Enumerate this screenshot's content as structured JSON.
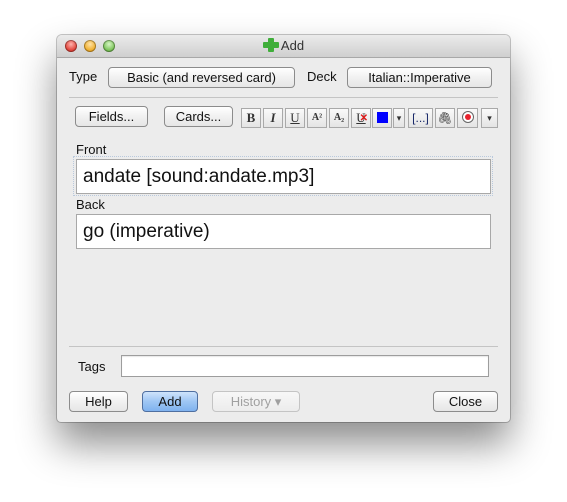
{
  "window": {
    "title": "Add",
    "title_icon": "add-plus-icon"
  },
  "top_row": {
    "type_label": "Type",
    "type_value": "Basic (and reversed card)",
    "deck_label": "Deck",
    "deck_value": "Italian::Imperative"
  },
  "toolbar": {
    "fields_label": "Fields...",
    "cards_label": "Cards...",
    "format_buttons": [
      {
        "name": "bold",
        "glyph": "B"
      },
      {
        "name": "italic",
        "glyph": "I"
      },
      {
        "name": "underline",
        "glyph": "U"
      },
      {
        "name": "superscript",
        "glyph": "A²"
      },
      {
        "name": "subscript",
        "glyph": "A₂"
      },
      {
        "name": "clear-formatting",
        "glyph": "U"
      },
      {
        "name": "text-color",
        "glyph": ""
      },
      {
        "name": "text-color-dropdown",
        "glyph": "▾"
      },
      {
        "name": "cloze",
        "glyph": "[...]"
      },
      {
        "name": "attach",
        "glyph": "⎘"
      },
      {
        "name": "record",
        "glyph": ""
      },
      {
        "name": "more-dropdown",
        "glyph": "▾"
      }
    ],
    "text_color": "#0000ff",
    "record_color": "#e8232e"
  },
  "fields": [
    {
      "label": "Front",
      "value": "andate [sound:andate.mp3]"
    },
    {
      "label": "Back",
      "value": "go (imperative)"
    }
  ],
  "tags": {
    "label": "Tags",
    "value": ""
  },
  "buttons": {
    "help": "Help",
    "add": "Add",
    "history": "History ▾",
    "close": "Close"
  }
}
